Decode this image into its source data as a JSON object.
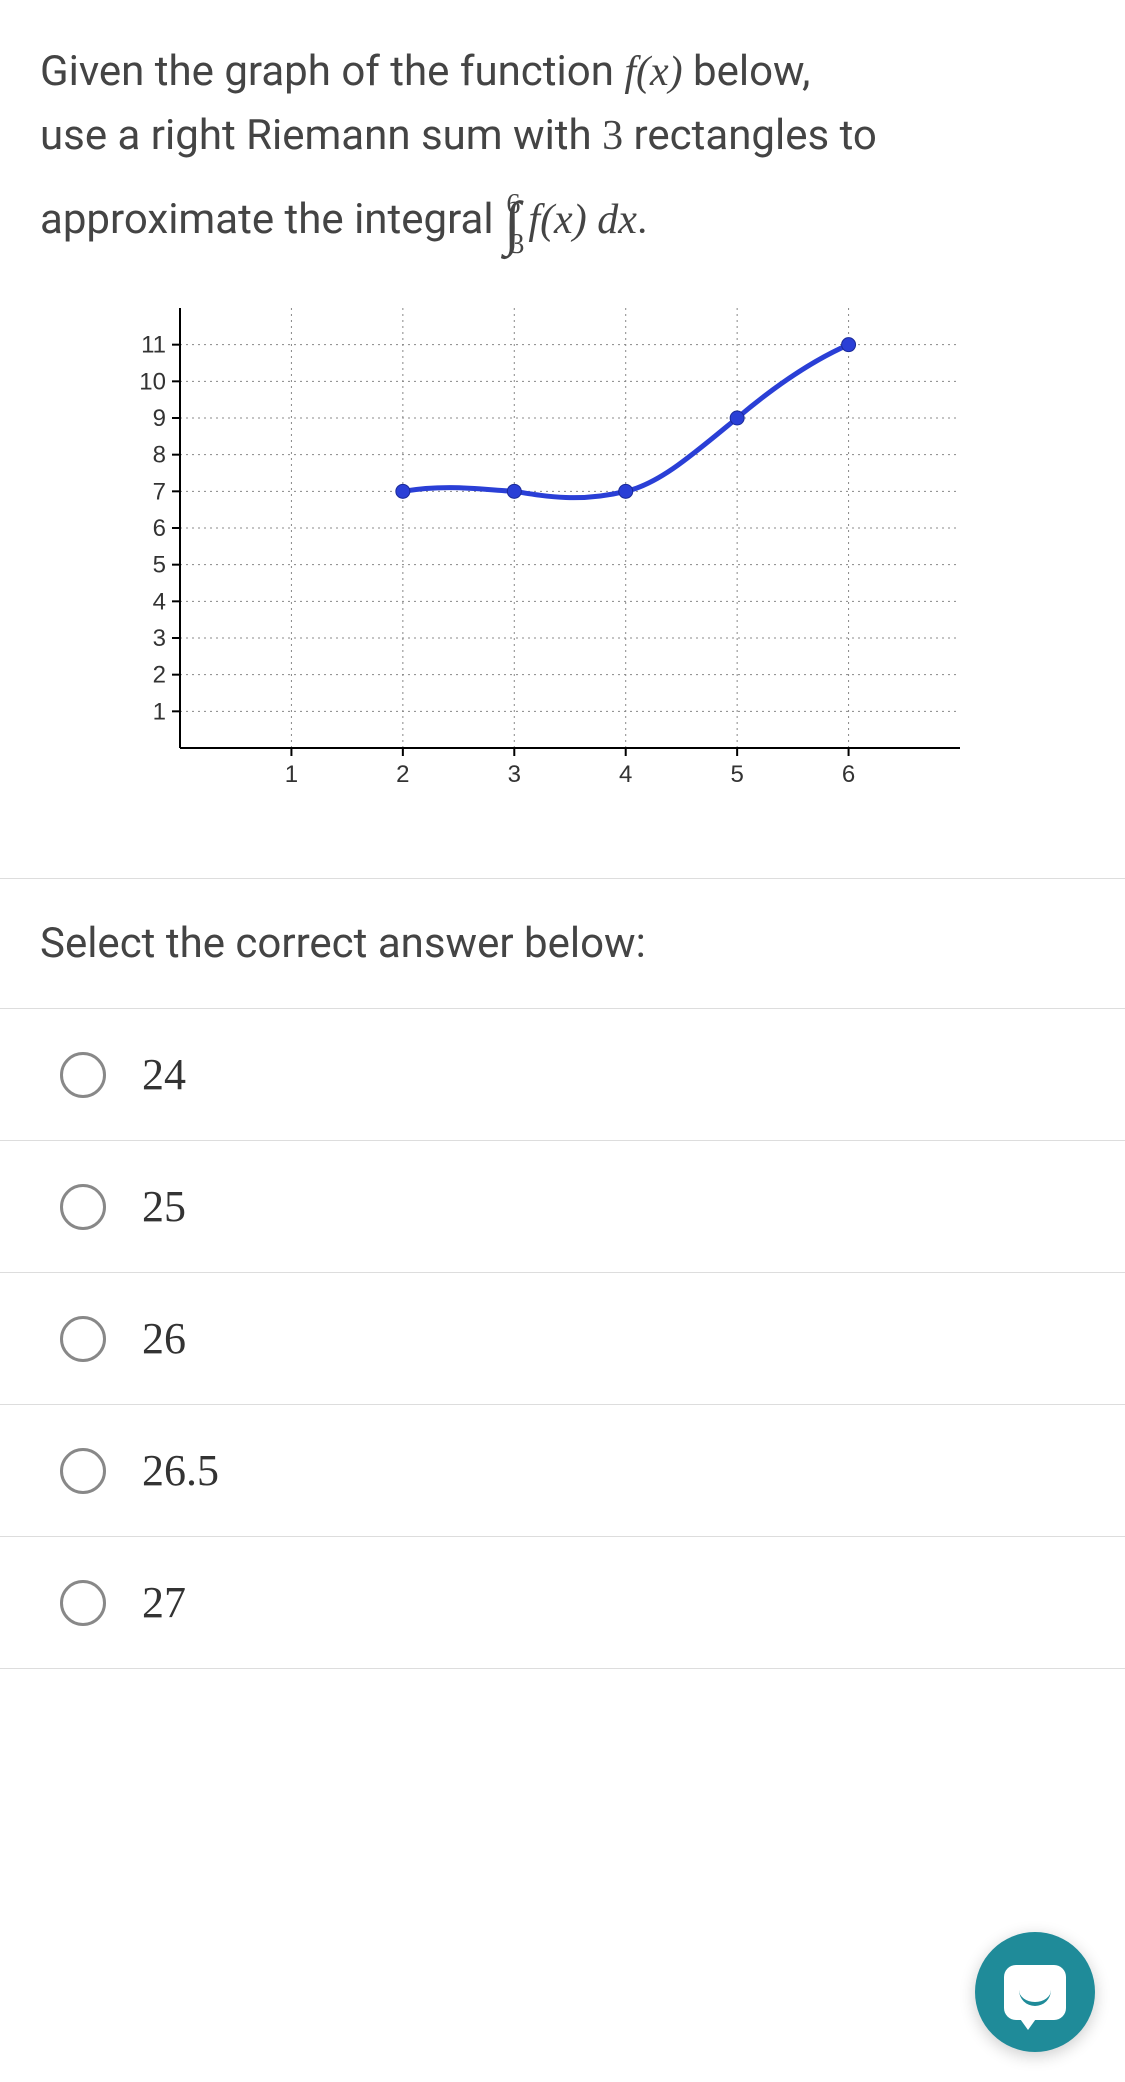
{
  "question": {
    "line1_prefix": "Given the graph of the function ",
    "fx": "f(x)",
    "line1_suffix": " below,",
    "line2": "use a right Riemann sum with ",
    "rect_count": "3",
    "line2_suffix": " rectangles to",
    "line3_prefix": "approximate the integral ",
    "int_lower": "3",
    "int_upper": "6",
    "integrand": "f(x) dx",
    "period": "."
  },
  "prompt": "Select the correct answer below:",
  "options": [
    "24",
    "25",
    "26",
    "26.5",
    "27"
  ],
  "chart_data": {
    "type": "line",
    "x": [
      2,
      3,
      4,
      5,
      6
    ],
    "y": [
      7,
      7,
      7,
      9,
      11
    ],
    "xlim": [
      0,
      7
    ],
    "ylim": [
      0,
      12
    ],
    "xticks": [
      1,
      2,
      3,
      4,
      5,
      6
    ],
    "yticks": [
      1,
      2,
      3,
      4,
      5,
      6,
      7,
      8,
      9,
      10,
      11
    ],
    "title": "",
    "xlabel": "",
    "ylabel": "",
    "grid": true
  },
  "chat": {
    "name": "chat-support-button"
  }
}
